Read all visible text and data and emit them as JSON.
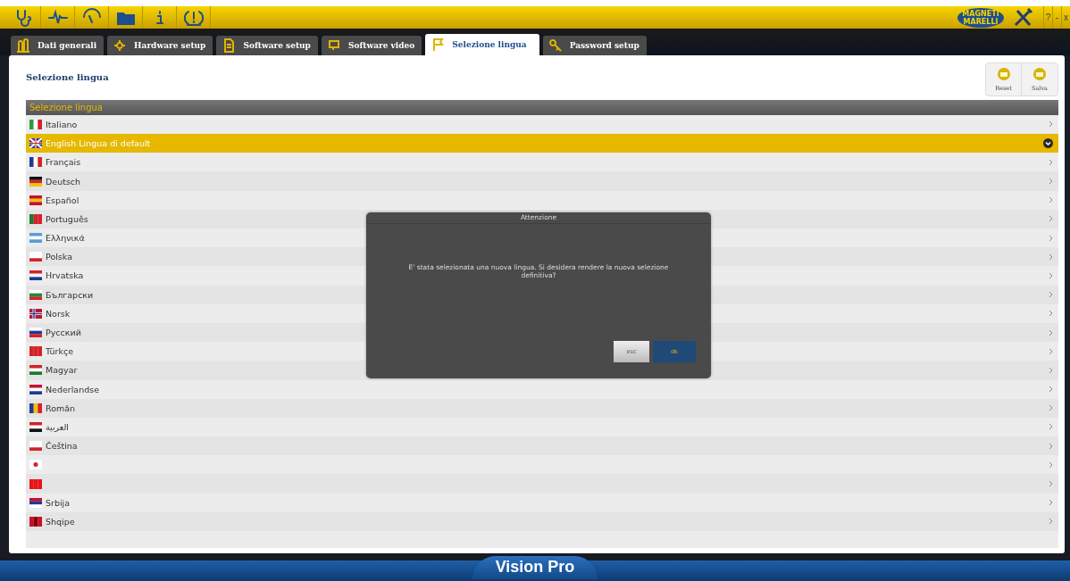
{
  "toolbar": {
    "logo": [
      "MAGNETI",
      "MARELLI"
    ],
    "window_buttons": [
      "?",
      "-",
      "x"
    ]
  },
  "tabs": [
    {
      "label": "Dati generali",
      "selected": false
    },
    {
      "label": "Hardware setup",
      "selected": false
    },
    {
      "label": "Software setup",
      "selected": false
    },
    {
      "label": "Software video",
      "selected": false
    },
    {
      "label": "Selezione lingua",
      "selected": true
    },
    {
      "label": "Password setup",
      "selected": false
    }
  ],
  "page": {
    "title": "Selezione lingua",
    "actions": [
      "Reset",
      "Salva"
    ]
  },
  "list": {
    "header": "Selezione lingua",
    "items": [
      {
        "label": "Italiano",
        "selected": false
      },
      {
        "label": "English Lingua di default",
        "selected": true
      },
      {
        "label": "Français",
        "selected": false
      },
      {
        "label": "Deutsch",
        "selected": false
      },
      {
        "label": "Español",
        "selected": false
      },
      {
        "label": "Português",
        "selected": false
      },
      {
        "label": "Ελληνικά",
        "selected": false
      },
      {
        "label": "Polska",
        "selected": false
      },
      {
        "label": "Hrvatska",
        "selected": false
      },
      {
        "label": "Български",
        "selected": false
      },
      {
        "label": "Norsk",
        "selected": false
      },
      {
        "label": "Русский",
        "selected": false
      },
      {
        "label": "Türkçe",
        "selected": false
      },
      {
        "label": "Magyar",
        "selected": false
      },
      {
        "label": "Nederlandse",
        "selected": false
      },
      {
        "label": "Român",
        "selected": false
      },
      {
        "label": "العربية",
        "selected": false
      },
      {
        "label": "Čeština",
        "selected": false
      },
      {
        "selected": false
      },
      {
        "selected": false
      },
      {
        "label": "Srbija",
        "selected": false
      },
      {
        "label": "Shqipe",
        "selected": false
      }
    ]
  },
  "dialog": {
    "title": "Attenzione",
    "message": "E' stata selezionata una nuova lingua. Si desidera rendere la nuova selezione definitiva?",
    "buttons": [
      {
        "label": "esc",
        "kind": "secondary"
      },
      {
        "label": "ok",
        "kind": "primary"
      }
    ]
  },
  "footer": {
    "title": "Vision Pro"
  }
}
